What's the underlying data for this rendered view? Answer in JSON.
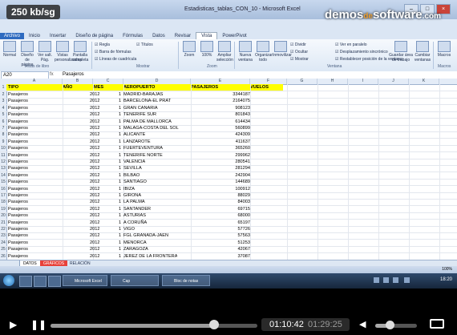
{
  "overlay": {
    "rate": "250 kb/sg",
    "brand_a": "demos",
    "brand_de": "de",
    "brand_b": "software",
    "brand_tld": ".com"
  },
  "window": {
    "title": "Estadisticas_tablas_CON_10 - Microsoft Excel",
    "btn_min": "–",
    "btn_max": "□",
    "btn_close": "×"
  },
  "ribbon_tabs": [
    "Archivo",
    "Inicio",
    "Insertar",
    "Diseño de página",
    "Fórmulas",
    "Datos",
    "Revisar",
    "Vista",
    "PowerPivot"
  ],
  "active_tab_index": 7,
  "ribbon": {
    "views": [
      {
        "label": "Normal"
      },
      {
        "label": "Diseño de página"
      },
      {
        "label": "Ver salt. Pág."
      },
      {
        "label": "Vistas personalizadas"
      },
      {
        "label": "Pantalla completa"
      }
    ],
    "group_views": "Vistas de libro",
    "show_checks": [
      "Regla",
      "Barra de fórmulas",
      "Líneas de cuadrícula",
      "Títulos"
    ],
    "group_show": "Mostrar",
    "zoom_buttons": [
      {
        "label": "Zoom"
      },
      {
        "label": "100%"
      },
      {
        "label": "Ampliar selección"
      }
    ],
    "group_zoom": "Zoom",
    "window_buttons": [
      {
        "label": "Nueva ventana"
      },
      {
        "label": "Organizar todo"
      },
      {
        "label": "Inmovilizar"
      }
    ],
    "window_checks": [
      "Dividir",
      "Ocultar",
      "Mostrar",
      "Ver en paralelo",
      "Desplazamiento sincrónico",
      "Restablecer posición de la ventana"
    ],
    "group_window": "Ventana",
    "save_area": {
      "label": "Guardar área de trabajo"
    },
    "switch_windows": {
      "label": "Cambiar ventanas"
    },
    "macros": {
      "label": "Macros"
    },
    "group_macros": "Macros"
  },
  "formula_bar": {
    "name_box": "A20",
    "fx": "fx",
    "value": "Pasajeros"
  },
  "columns": [
    "A",
    "B",
    "C",
    "D",
    "E",
    "F",
    "G",
    "H",
    "I",
    "J",
    "K"
  ],
  "table_header": {
    "tipo": "TIPO",
    "anio": "AÑO",
    "mes": "MES",
    "aeropuerto": "AEROPUERTO",
    "pasajeros": "PASAJEROS",
    "vuelos": "VUELOS"
  },
  "rows": [
    {
      "n": "2",
      "tipo": "Pasajeros",
      "anio": "2012",
      "mes": "1",
      "aero": "MADRID-BARAJAS",
      "pas": "3344187"
    },
    {
      "n": "3",
      "tipo": "Pasajeros",
      "anio": "2012",
      "mes": "1",
      "aero": "BARCELONA-EL PRAT",
      "pas": "2164075"
    },
    {
      "n": "4",
      "tipo": "Pasajeros",
      "anio": "2012",
      "mes": "1",
      "aero": "GRAN CANARIA",
      "pas": "908123"
    },
    {
      "n": "5",
      "tipo": "Pasajeros",
      "anio": "2012",
      "mes": "1",
      "aero": "TENERIFE SUR",
      "pas": "801843"
    },
    {
      "n": "6",
      "tipo": "Pasajeros",
      "anio": "2012",
      "mes": "1",
      "aero": "PALMA DE MALLORCA",
      "pas": "614434"
    },
    {
      "n": "7",
      "tipo": "Pasajeros",
      "anio": "2012",
      "mes": "1",
      "aero": "MALAGA-COSTA DEL SOL",
      "pas": "560899"
    },
    {
      "n": "8",
      "tipo": "Pasajeros",
      "anio": "2012",
      "mes": "1",
      "aero": "ALICANTE",
      "pas": "424309"
    },
    {
      "n": "9",
      "tipo": "Pasajeros",
      "anio": "2012",
      "mes": "1",
      "aero": "LANZAROTE",
      "pas": "411637"
    },
    {
      "n": "10",
      "tipo": "Pasajeros",
      "anio": "2012",
      "mes": "1",
      "aero": "FUERTEVENTURA",
      "pas": "365260"
    },
    {
      "n": "11",
      "tipo": "Pasajeros",
      "anio": "2012",
      "mes": "1",
      "aero": "TENERIFE NORTE",
      "pas": "299962"
    },
    {
      "n": "12",
      "tipo": "Pasajeros",
      "anio": "2012",
      "mes": "1",
      "aero": "VALENCIA",
      "pas": "280541"
    },
    {
      "n": "13",
      "tipo": "Pasajeros",
      "anio": "2012",
      "mes": "1",
      "aero": "SEVILLA",
      "pas": "281294"
    },
    {
      "n": "14",
      "tipo": "Pasajeros",
      "anio": "2012",
      "mes": "1",
      "aero": "BILBAO",
      "pas": "242904"
    },
    {
      "n": "15",
      "tipo": "Pasajeros",
      "anio": "2012",
      "mes": "1",
      "aero": "SANTIAGO",
      "pas": "144689"
    },
    {
      "n": "16",
      "tipo": "Pasajeros",
      "anio": "2012",
      "mes": "1",
      "aero": "IBIZA",
      "pas": "100912"
    },
    {
      "n": "17",
      "tipo": "Pasajeros",
      "anio": "2012",
      "mes": "1",
      "aero": "GIRONA",
      "pas": "88029"
    },
    {
      "n": "18",
      "tipo": "Pasajeros",
      "anio": "2012",
      "mes": "1",
      "aero": "LA PALMA",
      "pas": "84003"
    },
    {
      "n": "19",
      "tipo": "Pasajeros",
      "anio": "2012",
      "mes": "1",
      "aero": "SANTANDER",
      "pas": "69715"
    },
    {
      "n": "20",
      "tipo": "Pasajeros",
      "anio": "2012",
      "mes": "1",
      "aero": "ASTURIAS",
      "pas": "68000"
    },
    {
      "n": "21",
      "tipo": "Pasajeros",
      "anio": "2012",
      "mes": "1",
      "aero": "A CORUÑA",
      "pas": "65197"
    },
    {
      "n": "22",
      "tipo": "Pasajeros",
      "anio": "2012",
      "mes": "1",
      "aero": "VIGO",
      "pas": "57726"
    },
    {
      "n": "23",
      "tipo": "Pasajeros",
      "anio": "2012",
      "mes": "1",
      "aero": "FGL GRANADA-JAEN",
      "pas": "57563"
    },
    {
      "n": "24",
      "tipo": "Pasajeros",
      "anio": "2012",
      "mes": "1",
      "aero": "MENORCA",
      "pas": "51253"
    },
    {
      "n": "25",
      "tipo": "Pasajeros",
      "anio": "2012",
      "mes": "1",
      "aero": "ZARAGOZA",
      "pas": "42067"
    },
    {
      "n": "26",
      "tipo": "Pasajeros",
      "anio": "2012",
      "mes": "1",
      "aero": "JEREZ DE LA FRONTERA",
      "pas": "37087"
    }
  ],
  "sheet_tabs": [
    "DATOS",
    "GRÁFICOS",
    "RELACIÓN"
  ],
  "status": {
    "zoom": "100%"
  },
  "taskbar": {
    "task1": "Microsoft Excel",
    "task2": "Cap",
    "task3": "Bloc de notas",
    "clock": "18:20"
  },
  "player": {
    "current_time": "01:10:42",
    "duration": "01:29:25",
    "progress_fraction": 0.79,
    "volume_fraction": 0.35
  },
  "colors": {
    "highlight": "#ffff00",
    "excel_blue": "#2e6bc0",
    "sheet_red": "#e8423a"
  }
}
